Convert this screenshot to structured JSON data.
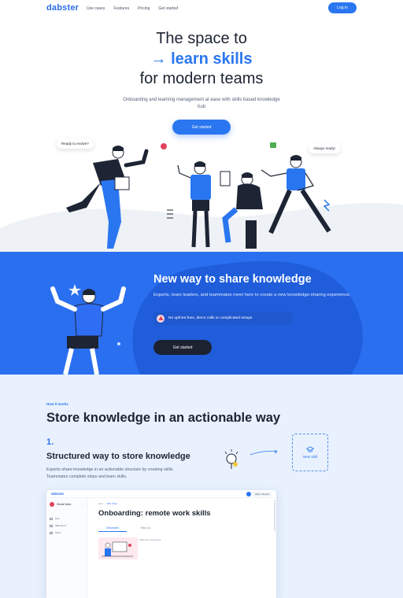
{
  "nav": {
    "logo": "dabster",
    "links": [
      "Use cases",
      "Features",
      "Pricing",
      "Get started"
    ],
    "login": "Log in"
  },
  "hero": {
    "line1": "The space to",
    "line2": "→ learn skills",
    "line3": "for modern teams",
    "subtitle": "Onboarding and learning management at ease with skills based knowledge hub",
    "cta": "Get started",
    "bubble_left": "Ready to evolve?",
    "bubble_right": "Always ready!"
  },
  "band": {
    "title": "New way to share knowledge",
    "subtitle": "Experts, team leaders, and teammates meet here to create a new knowledge-sharing experience.",
    "chip": "No upfront fees, demo calls or complicated setups",
    "cta": "Get started"
  },
  "how": {
    "kicker": "How it works",
    "title": "Store knowledge in an actionable way",
    "step_number": "1.",
    "step_title": "Structured way to store knowledge",
    "step_desc": "Experts share knowledge in  an actionable structure by creating skills. Teammates complete steps and learn skills.",
    "new_skill": "New skill"
  },
  "mock": {
    "logo": "dabster",
    "user": "Ellen Stewart",
    "org": "Global Sales",
    "nav": [
      "Hub",
      "Skill cloud",
      "Team"
    ],
    "crumb_root": "Hub",
    "crumb_current": "Skill cloud",
    "title": "Onboarding: remote work skills",
    "tabs": [
      "Description",
      "Steps (4)"
    ],
    "desc_label": "Skills short description"
  },
  "colors": {
    "accent": "#2a76f0",
    "band": "#2a6ff0",
    "dark": "#1c2230",
    "how_bg": "#e8f1fd"
  }
}
